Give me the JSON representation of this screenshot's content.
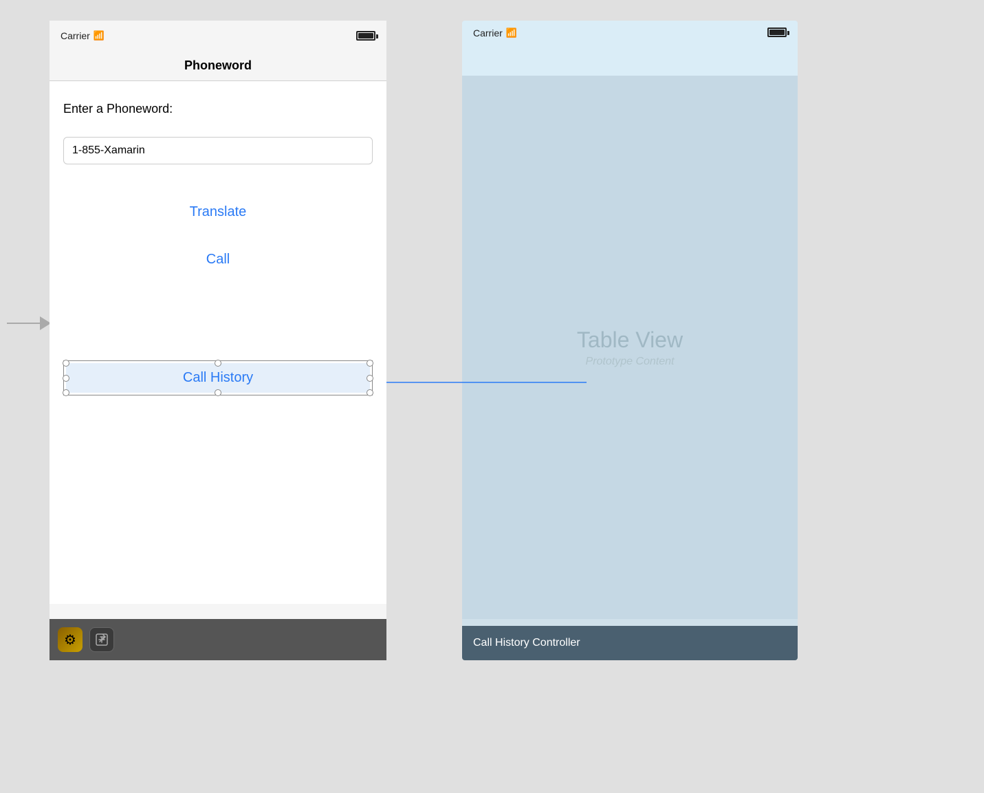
{
  "left_phone": {
    "status_bar": {
      "carrier": "Carrier",
      "wifi_symbol": "📶",
      "battery_label": "battery"
    },
    "nav_bar": {
      "title": "Phoneword"
    },
    "content": {
      "enter_label": "Enter a Phoneword:",
      "input_value": "1-855-Xamarin",
      "input_placeholder": "1-855-Xamarin",
      "translate_button": "Translate",
      "call_button": "Call",
      "call_history_button": "Call History"
    },
    "toolbar": {
      "gear_icon": "gear-icon",
      "export_icon": "export-icon"
    }
  },
  "right_phone": {
    "status_bar": {
      "carrier": "Carrier",
      "wifi_symbol": "📶",
      "battery_label": "battery"
    },
    "table_view": {
      "label": "Table View",
      "sublabel": "Prototype Content"
    },
    "footer": {
      "label": "Call History Controller"
    }
  },
  "arrow": {
    "label": "arrow"
  },
  "colors": {
    "blue_button": "#2a7af5",
    "selection_border": "#888888",
    "connector_line": "#2a7af5"
  }
}
